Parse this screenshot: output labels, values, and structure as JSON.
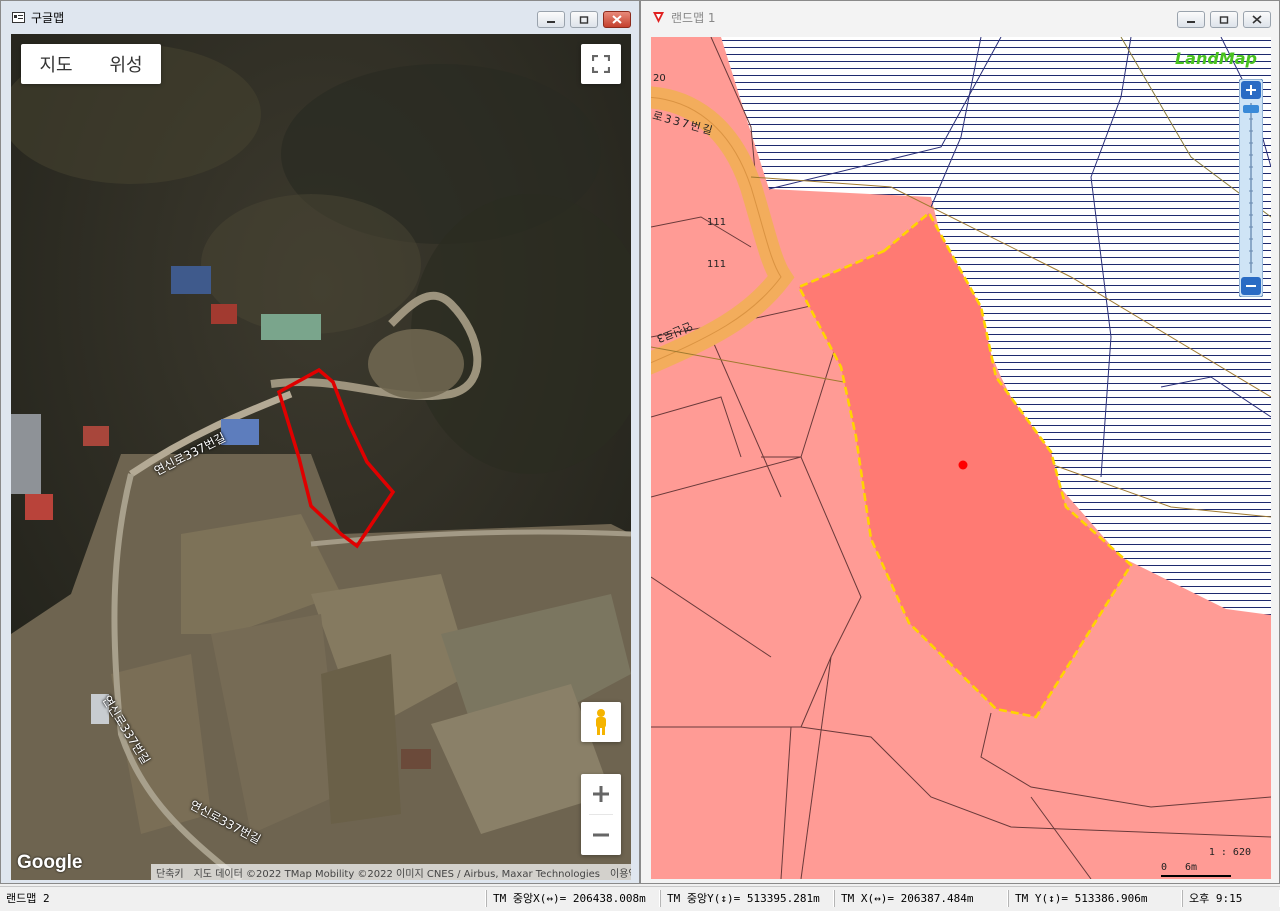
{
  "left_window": {
    "title": "구글맵",
    "map_type_buttons": [
      "지도",
      "위성"
    ],
    "road_labels": [
      "연신로337번길",
      "연신로337번길",
      "연신로337번길"
    ],
    "logo": "Google",
    "attribution": [
      "단축키",
      "지도 데이터 ©2022 TMap Mobility ©2022 이미지 CNES / Airbus, Maxar Technologies",
      "이용약관"
    ]
  },
  "right_window": {
    "title": "랜드맵 1",
    "logo": "LandMap",
    "parcel_numbers": [
      "20",
      "111",
      "111"
    ],
    "road_labels": [
      "로337번길",
      "연신로3"
    ],
    "scale_ratio": "1 : 620",
    "scale_ticks": [
      "0",
      "6m"
    ]
  },
  "statusbar": {
    "app_name": "랜드맵 2",
    "tm_center_x": "TM 중앙X(↔)= 206438.008m",
    "tm_center_y": "TM 중앙Y(↕)= 513395.281m",
    "tm_x": "TM X(↔)= 206387.484m",
    "tm_y": "TM Y(↕)= 513386.906m",
    "time": "오후 9:15"
  },
  "colors": {
    "parcel_outline_google": "#e00000",
    "selected_parcel_fill": "#ff7a73",
    "selected_parcel_border": "#ffd400",
    "base_zone_fill": "#ff9b95",
    "road_fill": "#f3ad5c"
  }
}
